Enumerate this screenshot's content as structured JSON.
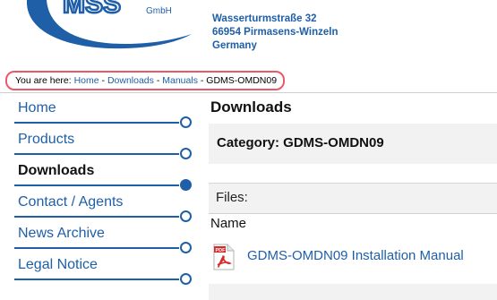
{
  "logo": {
    "text": "MSS",
    "suffix": "GmbH"
  },
  "address": {
    "street": "Wasserturmstraße 32",
    "city": "66954 Pirmasens-Winzeln",
    "country": "Germany"
  },
  "breadcrumb": {
    "prefix": "You are here:",
    "items": [
      "Home",
      "Downloads",
      "Manuals"
    ],
    "separator": "-",
    "current": "GDMS-OMDN09"
  },
  "nav": {
    "items": [
      {
        "label": "Home",
        "active": false
      },
      {
        "label": "Products",
        "active": false
      },
      {
        "label": "Downloads",
        "active": true
      },
      {
        "label": "Contact / Agents",
        "active": false
      },
      {
        "label": "News Archive",
        "active": false
      },
      {
        "label": "Legal Notice",
        "active": false
      }
    ]
  },
  "main": {
    "title": "Downloads",
    "category": "Category: GDMS-OMDN09",
    "files_label": "Files:",
    "column_name": "Name",
    "files": [
      {
        "name": "GDMS-OMDN09 Installation Manual",
        "icon": "pdf-icon",
        "icon_text": "PDF"
      }
    ]
  },
  "colors": {
    "link": "#1f5fa8",
    "highlight": "#e85a6a",
    "panel": "#f2f2f2",
    "pdf": "#d62a2a"
  }
}
